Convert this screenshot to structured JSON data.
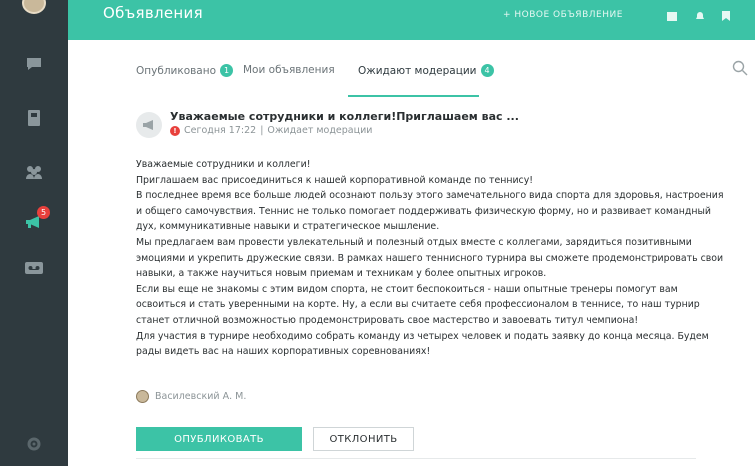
{
  "app": {
    "accent": "#3cc3a6",
    "sidebar_bg": "#2f3a3f"
  },
  "sidebar": {
    "items": [
      {
        "name": "avatar",
        "icon": "user-avatar"
      },
      {
        "name": "chat",
        "icon": "chat-icon"
      },
      {
        "name": "book",
        "icon": "book-icon"
      },
      {
        "name": "people",
        "icon": "people-icon"
      },
      {
        "name": "announcements",
        "icon": "megaphone-icon",
        "badge": "5"
      },
      {
        "name": "voicemail",
        "icon": "voicemail-icon"
      },
      {
        "name": "settings",
        "icon": "gear-icon"
      }
    ]
  },
  "topbar": {
    "title": "Объявления",
    "new_label": "+ НОВОЕ ОБЪЯВЛЕНИЕ"
  },
  "tabs": [
    {
      "label": "Опубликовано",
      "badge": "1"
    },
    {
      "label": "Мои объявления",
      "badge": ""
    },
    {
      "label": "Ожидают модерации",
      "badge": "4"
    }
  ],
  "post": {
    "title": "Уважаемые сотрудники и коллеги!Приглашаем вас ...",
    "time": "Сегодня 17:22",
    "separator": "|",
    "status": "Ожидает модерации",
    "lines": [
      "Уважаемые сотрудники и коллеги!",
      "Приглашаем вас присоединиться к нашей корпоративной команде по теннису!",
      "В последнее время все больше людей осознают пользу этого замечательного вида спорта для здоровья, настроения",
      "и общего самочувствия. Теннис не только помогает поддерживать физическую форму, но и развивает командный",
      "дух, коммуникативные навыки и стратегическое мышление.",
      "Мы предлагаем вам провести увлекательный и полезный отдых вместе с коллегами, зарядиться позитивными",
      "эмоциями и укрепить дружеские связи. В рамках нашего теннисного турнира вы сможете продемонстрировать свои",
      "навыки, а также научиться новым приемам и техникам у более опытных игроков.",
      "Если вы еще не знакомы с этим видом спорта, не стоит беспокоиться - наши опытные тренеры помогут вам",
      "освоиться и стать уверенными на корте. Ну, а если вы считаете себя профессионалом в теннисе, то наш турнир",
      "станет отличной возможностью продемонстрировать свое мастерство и завоевать титул чемпиона!",
      "Для участия в турнире необходимо собрать команду из четырех человек и подать заявку до конца месяца. Будем",
      "рады видеть вас на наших корпоративных соревнованиях!"
    ],
    "author": "Василевский А. М."
  },
  "actions": {
    "publish_label": "ОПУБЛИКОВАТЬ",
    "reject_label": "ОТКЛОНИТЬ"
  }
}
